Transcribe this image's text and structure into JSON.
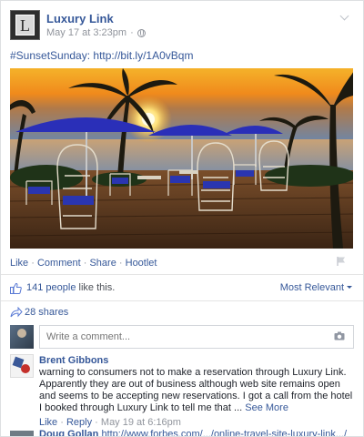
{
  "post": {
    "page_name": "Luxury Link",
    "logo_letter": "L",
    "timestamp": "May 17 at 3:23pm",
    "separator": "·",
    "text": "#SunsetSunday: http://bit.ly/1A0vBqm"
  },
  "actions": {
    "like": "Like",
    "comment": "Comment",
    "share": "Share",
    "hootlet": "Hootlet",
    "sep": "·"
  },
  "likes": {
    "count_text": "141 people",
    "suffix": " like this.",
    "sort_label": "Most Relevant"
  },
  "shares": {
    "label": "28 shares"
  },
  "composer": {
    "placeholder": "Write a comment..."
  },
  "comments": [
    {
      "author": "Brent Gibbons",
      "text": "warning to consumers not to make a reservation through Luxury Link. Apparently they are out of business although web site remains open and seems to be accepting new reservations. I got a call from the hotel I booked through Luxury Link to tell me that ...",
      "see_more": "See More",
      "like": "Like",
      "reply": "Reply",
      "time": "May 19 at 6:16pm"
    },
    {
      "author": "Doug Gollan",
      "text": "http://www.forbes.com/.../online-travel-site-luxury-link.../"
    }
  ],
  "colors": {
    "link": "#365899",
    "meta": "#90949c",
    "umbrella": "#2a2fb8"
  }
}
